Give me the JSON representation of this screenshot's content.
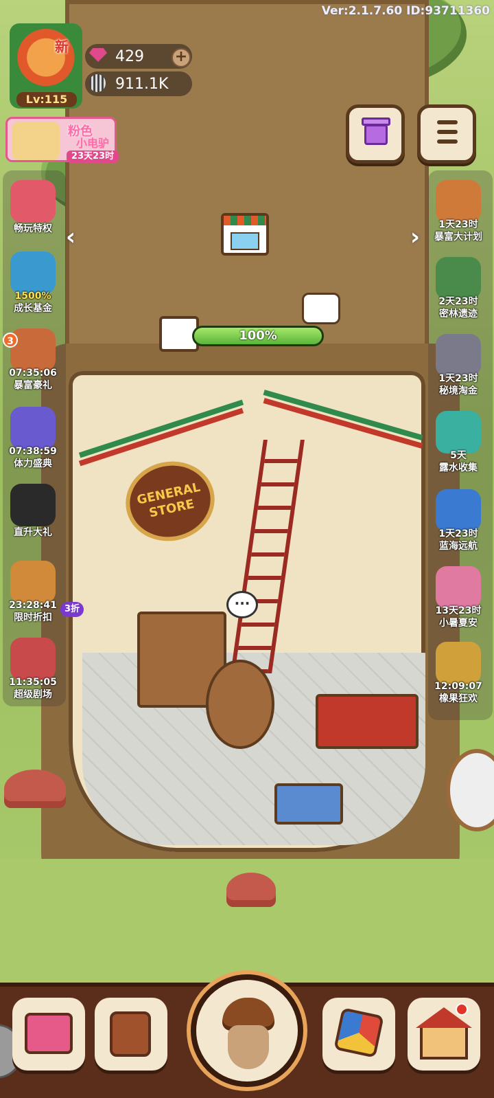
{
  "version_text": "Ver:2.1.7.60 ID:93711360",
  "profile": {
    "level": "Lv:115",
    "new_tag": "新"
  },
  "currency": {
    "gems": "429",
    "seeds": "911.1K"
  },
  "banner": {
    "title1": "粉色",
    "title2": "小电驴",
    "timer": "23天23时"
  },
  "left_side": [
    {
      "icon": "vip-icon",
      "timer": "",
      "label": "畅玩特权"
    },
    {
      "icon": "growth-fund-icon",
      "timer": "",
      "label": "成长基金",
      "extra": "1500%"
    },
    {
      "icon": "rich-gift-icon",
      "timer": "07:35:06",
      "label": "暴富豪礼",
      "badge": "3"
    },
    {
      "icon": "lightning-icon",
      "timer": "07:38:59",
      "label": "体力盛典"
    },
    {
      "icon": "cat-icon",
      "timer": "",
      "label": "直升大礼"
    },
    {
      "icon": "alarm-clock-icon",
      "timer": "23:28:41",
      "label": "限时折扣",
      "discount": "3折"
    },
    {
      "icon": "theater-icon",
      "timer": "11:35:05",
      "label": "超级剧场"
    }
  ],
  "right_side": [
    {
      "icon": "raccoon-plan-icon",
      "timer": "1天23时",
      "label": "暴富大计划"
    },
    {
      "icon": "forest-ruins-icon",
      "timer": "2天23时",
      "label": "密林遗迹"
    },
    {
      "icon": "mine-cart-icon",
      "timer": "1天23时",
      "label": "秘境淘金"
    },
    {
      "icon": "dew-drop-icon",
      "timer": "5天",
      "label": "露水收集"
    },
    {
      "icon": "boat-icon",
      "timer": "1天23时",
      "label": "蓝海远航"
    },
    {
      "icon": "summer-fan-icon",
      "timer": "13天23时",
      "label": "小暑夏安"
    },
    {
      "icon": "nut-party-icon",
      "timer": "12:09:07",
      "label": "橡果狂欢"
    }
  ],
  "building": {
    "progress_pct": 100,
    "progress_text": "100%",
    "sign_text": "GENERAL STORE"
  },
  "colors": {
    "accent_pink": "#e04a8a",
    "progress_green": "#5ab43a",
    "bar_brown": "#5a2e1a"
  },
  "bottom_nav": [
    {
      "icon": "shop-cart-icon"
    },
    {
      "icon": "cheers-icon"
    },
    {
      "icon": "acorn-icon"
    },
    {
      "icon": "dice-icon"
    },
    {
      "icon": "house-icon"
    }
  ]
}
